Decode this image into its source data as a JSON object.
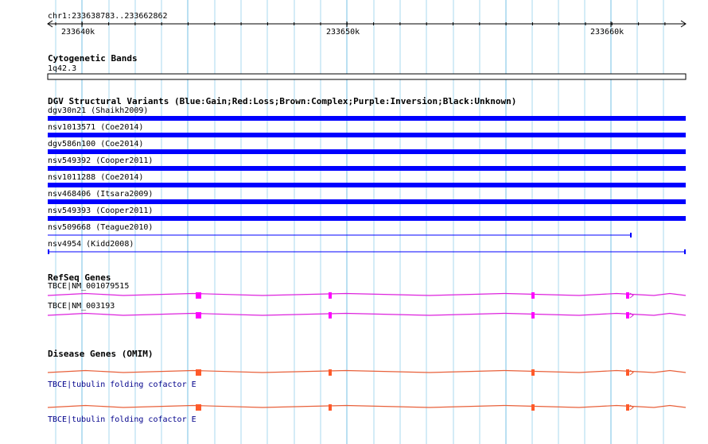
{
  "ruler": {
    "range_label": "chr1:233638783..233662862",
    "ticks": [
      "233640k",
      "233650k",
      "233660k"
    ]
  },
  "cytobands": {
    "title": "Cytogenetic Bands",
    "band_label": "1q42.3"
  },
  "dgv": {
    "title": "DGV Structural Variants (Blue:Gain;Red:Loss;Brown:Complex;Purple:Inversion;Black:Unknown)",
    "gain_color": "#0000ff",
    "variants": [
      {
        "label": "dgv30n21 (Shaikh2009)",
        "style": "bar"
      },
      {
        "label": "nsv1013571 (Coe2014)",
        "style": "bar"
      },
      {
        "label": "dgv586n100 (Coe2014)",
        "style": "bar"
      },
      {
        "label": "nsv549392 (Cooper2011)",
        "style": "bar"
      },
      {
        "label": "nsv1011288 (Coe2014)",
        "style": "bar"
      },
      {
        "label": "nsv468406 (Itsara2009)",
        "style": "bar"
      },
      {
        "label": "nsv549393 (Cooper2011)",
        "style": "bar"
      },
      {
        "label": "nsv509668 (Teague2010)",
        "style": "line-partial"
      },
      {
        "label": "nsv4954 (Kidd2008)",
        "style": "line-full"
      }
    ]
  },
  "refseq": {
    "title": "RefSeq Genes",
    "color": "#dd22dd",
    "exon_color": "#ff00ff",
    "genes": [
      {
        "label": "TBCE|NM_001079515"
      },
      {
        "label": "TBCE|NM_003193"
      }
    ]
  },
  "omim": {
    "title": "Disease Genes (OMIM)",
    "color": "#e8603a",
    "exon_color": "#ff5a2a",
    "label_color": "#00008b",
    "genes": [
      {
        "label": "TBCE|tubulin folding cofactor E"
      },
      {
        "label": "TBCE|tubulin folding cofactor E"
      }
    ]
  },
  "grid_color": "#a9d8ef"
}
